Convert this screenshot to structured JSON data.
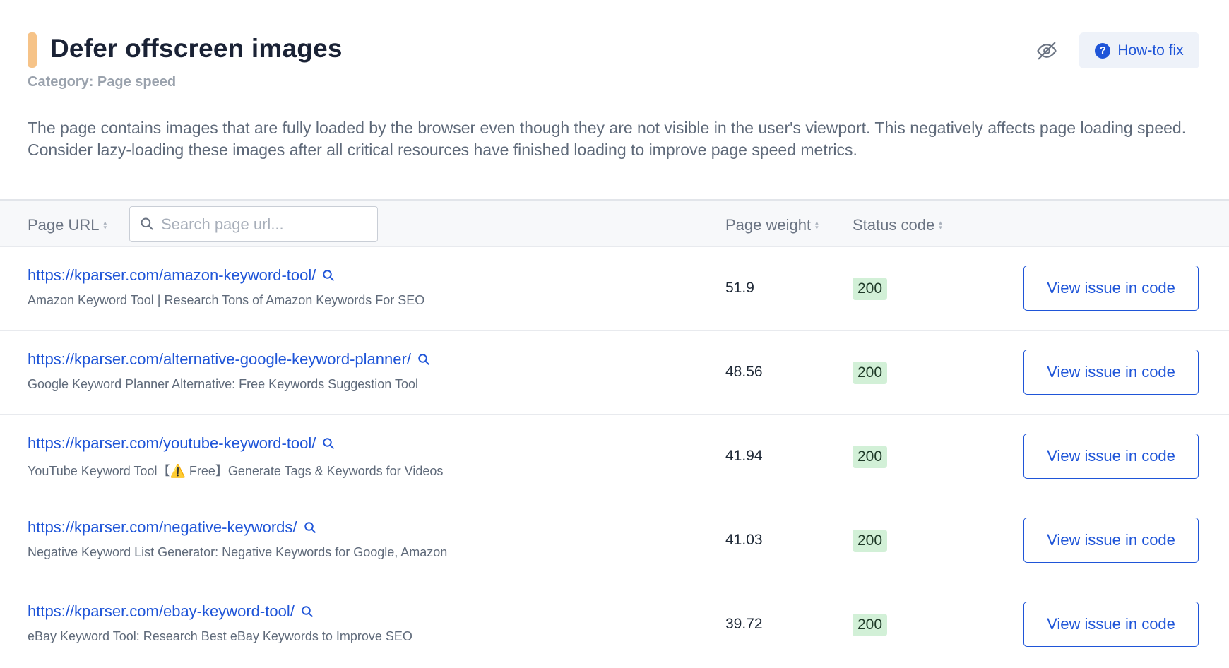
{
  "issue": {
    "title": "Defer offscreen images",
    "category": "Category: Page speed",
    "description": "The page contains images that are fully loaded by the browser even though they are not visible in the user's viewport. This negatively affects page loading speed. Consider lazy-loading these images after all critical resources have finished loading to improve page speed metrics.",
    "accent_color": "#f6c388"
  },
  "actions": {
    "hide_icon": "eye-off-icon",
    "howto_label": "How-to fix",
    "howto_icon": "question-circle-icon"
  },
  "table": {
    "columns": {
      "page_url": "Page URL",
      "page_weight": "Page weight",
      "status_code": "Status code"
    },
    "search": {
      "placeholder": "Search page url...",
      "value": ""
    },
    "view_button_label": "View issue in code",
    "rows": [
      {
        "url": "https://kparser.com/amazon-keyword-tool/",
        "title": "Amazon Keyword Tool | Research Tons of Amazon Keywords For SEO",
        "weight": "51.9",
        "status": "200"
      },
      {
        "url": "https://kparser.com/alternative-google-keyword-planner/",
        "title": "Google Keyword Planner Alternative: Free Keywords Suggestion Tool",
        "weight": "48.56",
        "status": "200"
      },
      {
        "url": "https://kparser.com/youtube-keyword-tool/",
        "title": "YouTube Keyword Tool【⚠️ Free】Generate Tags & Keywords for Videos",
        "weight": "41.94",
        "status": "200"
      },
      {
        "url": "https://kparser.com/negative-keywords/",
        "title": "Negative Keyword List Generator: Negative Keywords for Google, Amazon",
        "weight": "41.03",
        "status": "200"
      },
      {
        "url": "https://kparser.com/ebay-keyword-tool/",
        "title": "eBay Keyword Tool: Research Best eBay Keywords to Improve SEO",
        "weight": "39.72",
        "status": "200"
      }
    ]
  },
  "colors": {
    "link": "#1f55d8",
    "status_ok_bg": "#d2f0d7"
  }
}
